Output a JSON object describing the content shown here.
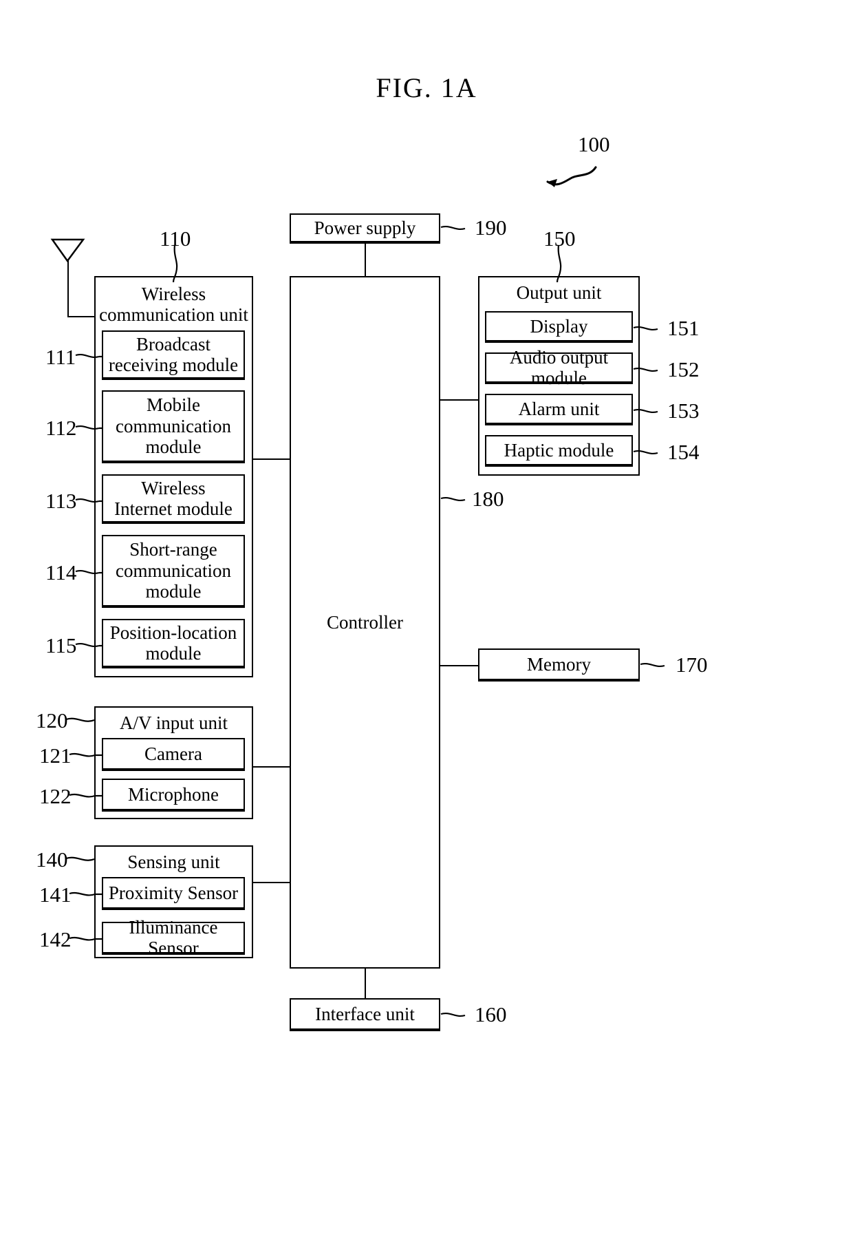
{
  "figure": {
    "title": "FIG.  1A",
    "device_ref": "100"
  },
  "blocks": {
    "power_supply": {
      "label": "Power supply",
      "ref": "190"
    },
    "controller": {
      "label": "Controller",
      "ref": "180"
    },
    "memory": {
      "label": "Memory",
      "ref": "170"
    },
    "interface": {
      "label": "Interface unit",
      "ref": "160"
    },
    "wireless": {
      "label": "Wireless\ncommunication unit",
      "label_line1": "Wireless",
      "label_line2": "communication unit",
      "ref": "110",
      "modules": [
        {
          "ref": "111",
          "label": "Broadcast\nreceiving module",
          "line1": "Broadcast",
          "line2": "receiving module",
          "line3": ""
        },
        {
          "ref": "112",
          "label": "Mobile\ncommunication\nmodule",
          "line1": "Mobile",
          "line2": "communication",
          "line3": "module"
        },
        {
          "ref": "113",
          "label": "Wireless\nInternet module",
          "line1": "Wireless",
          "line2": "Internet module",
          "line3": ""
        },
        {
          "ref": "114",
          "label": "Short-range\ncommunication\nmodule",
          "line1": "Short-range",
          "line2": "communication",
          "line3": "module"
        },
        {
          "ref": "115",
          "label": "Position-location\nmodule",
          "line1": "Position-location",
          "line2": "module",
          "line3": ""
        }
      ]
    },
    "av_input": {
      "label": "A/V input unit",
      "ref": "120",
      "modules": [
        {
          "ref": "121",
          "label": "Camera"
        },
        {
          "ref": "122",
          "label": "Microphone"
        }
      ]
    },
    "sensing": {
      "label": "Sensing unit",
      "ref": "140",
      "modules": [
        {
          "ref": "141",
          "label": "Proximity Sensor"
        },
        {
          "ref": "142",
          "label": "Illuminance Sensor"
        }
      ]
    },
    "output": {
      "label": "Output unit",
      "ref": "150",
      "modules": [
        {
          "ref": "151",
          "label": "Display"
        },
        {
          "ref": "152",
          "label": "Audio output module"
        },
        {
          "ref": "153",
          "label": "Alarm  unit"
        },
        {
          "ref": "154",
          "label": "Haptic module"
        }
      ]
    }
  },
  "colors": {
    "stroke": "#000000",
    "background": "#ffffff"
  }
}
